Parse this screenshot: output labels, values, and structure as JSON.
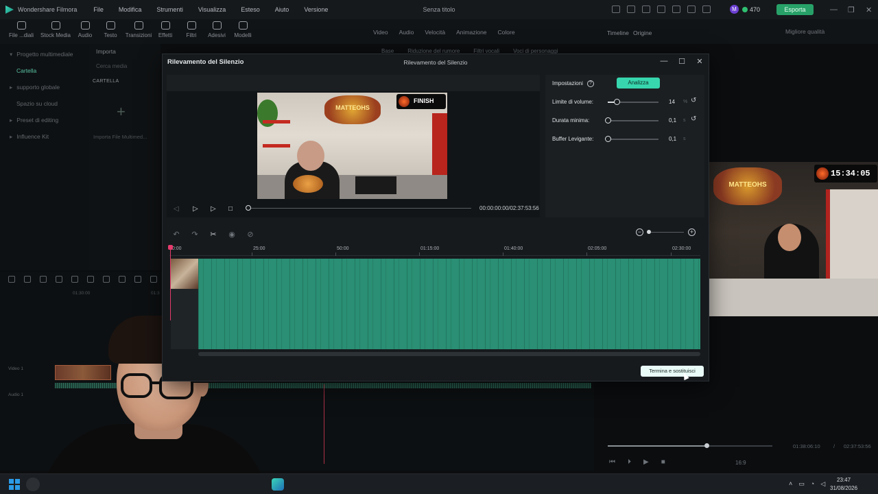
{
  "app": {
    "name": "Wondershare Filmora",
    "window_title": "Senza titolo",
    "menu": [
      "File",
      "Modifica",
      "Strumenti",
      "Visualizza",
      "Esteso",
      "Aiuto",
      "Versione"
    ],
    "credits": "470",
    "export_label": "Esporta",
    "avatar_letter": "M"
  },
  "toolbar": {
    "tools": [
      "File ...diali",
      "Stock Media",
      "Audio",
      "Testo",
      "Transizioni",
      "Effetti",
      "Filtri",
      "Adesivi",
      "Modelli"
    ],
    "prop_tabs": [
      "Video",
      "Audio",
      "Velocità",
      "Animazione",
      "Colore"
    ],
    "timeline_label": "Timeline",
    "origin_label": "Origine",
    "quality": "Migliore qualità",
    "sub_tabs": [
      "Base",
      "Riduzione del rumore",
      "Filtri vocali",
      "Voci di personaggi"
    ]
  },
  "left_panel": {
    "items": [
      "Progetto multimediale",
      "Cartella",
      "supporto globale",
      "Spazio su cloud",
      "Preset di editing",
      "Influence Kit"
    ],
    "import_label": "Importa",
    "search_placeholder": "Cerca media",
    "folder_label": "CARTELLA",
    "import_media_label": "Importa File Multimed..."
  },
  "preview": {
    "sign_text": "MATTEOHS",
    "clock_text": "15:34:05",
    "time_current": "01:38:06:10",
    "time_separator": "/",
    "time_total": "02:37:53:56",
    "ratio": "16:9",
    "progress": 0.6
  },
  "bg_timeline": {
    "ruler": [
      "01:30:00",
      "01:3"
    ],
    "video_track": "Video 1",
    "audio_track": "Audio 1"
  },
  "dialog": {
    "title": "Rilevamento del Silenzio",
    "title_center": "Rilevamento del Silenzio",
    "frame": {
      "sign_text": "MATTEOHS",
      "badge_text": "FINISH"
    },
    "time": "00:00:00:00/02:37:53:56",
    "settings": {
      "label": "Impostazioni",
      "analyze_label": "Analizza",
      "rows": [
        {
          "label": "Limite di volume:",
          "value": "14",
          "unit": "%",
          "level": 0.18
        },
        {
          "label": "Durata minima:",
          "value": "0,1",
          "unit": "s",
          "level": 0.0
        },
        {
          "label": "Buffer Levigante:",
          "value": "0,1",
          "unit": "s",
          "level": 0.0
        }
      ]
    },
    "ruler": [
      "00:00",
      "25:00",
      "50:00",
      "01:15:00",
      "01:40:00",
      "02:05:00",
      "02:30:00"
    ],
    "finish_label": "Termina e sostituisci"
  },
  "taskbar": {
    "time": "23:47",
    "date": "31/08/2026"
  }
}
